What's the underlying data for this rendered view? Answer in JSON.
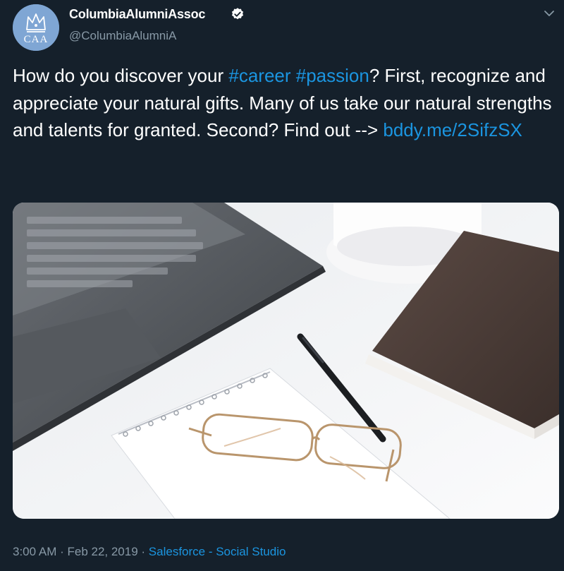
{
  "author": {
    "display_name": "ColumbiaAlumniAssoc",
    "handle": "@ColumbiaAlumniA",
    "avatar_text": "CAA",
    "verified_icon": "verified-badge-icon"
  },
  "tweet": {
    "text_parts": {
      "p1": "How do you discover your ",
      "hashtag_career": "#career",
      "sp1": " ",
      "hashtag_passion": "#passion",
      "p2": "? First, recognize and appreciate your natural gifts. Many of us take our natural strengths and talents for granted. Second? Find out --> ",
      "link": "bddy.me/2SifzSX"
    }
  },
  "media": {
    "icon": "photo-laptop-notebook-glasses-pen"
  },
  "meta": {
    "time": "3:00 AM",
    "sep1": " · ",
    "date": "Feb 22, 2019",
    "sep2": " · ",
    "source": "Salesforce - Social Studio"
  },
  "colors": {
    "background": "#15202b",
    "link": "#1b95e0",
    "secondary_text": "#8899a6"
  }
}
